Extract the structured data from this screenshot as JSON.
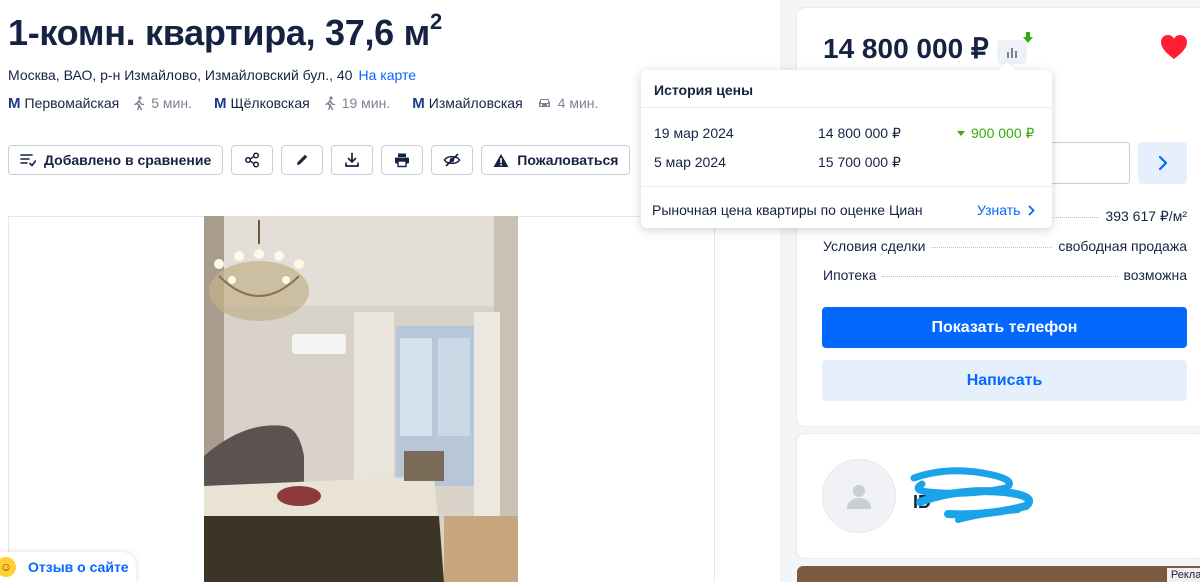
{
  "listing": {
    "title": "1-комн. квартира, 37,6 м",
    "title_sup": "2",
    "address": "Москва, ВАО, р-н Измайлово, Измайловский бул., 40",
    "map_link": "На карте"
  },
  "metro": [
    {
      "station": "Первомайская",
      "time": "5 мин.",
      "mode": "walk-icon"
    },
    {
      "station": "Щёлковская",
      "time": "19 мин.",
      "mode": "walk-icon"
    },
    {
      "station": "Измайловская",
      "time": "4 мин.",
      "mode": "car-icon"
    }
  ],
  "metro_icon_letter": "M",
  "actions": {
    "compare_label": "Добавлено в сравнение",
    "report_label": "Пожаловаться"
  },
  "price": {
    "value": "14 800 000 ₽",
    "per_meter": "393 617 ₽/м²"
  },
  "details": [
    {
      "key": "Условия сделки",
      "value": "свободная продажа"
    },
    {
      "key": "Ипотека",
      "value": "возможна"
    }
  ],
  "buttons": {
    "phone": "Показать телефон",
    "write": "Написать"
  },
  "agent": {
    "id_text": "ID"
  },
  "price_history": {
    "title": "История цены",
    "rows": [
      {
        "date": "19 мар 2024",
        "price": "14 800 000 ₽",
        "diff": "900 000 ₽"
      },
      {
        "date": "5 мар 2024",
        "price": "15 700 000 ₽",
        "diff": ""
      }
    ],
    "market_text": "Рыночная цена квартиры по оценке Циан",
    "market_link": "Узнать"
  },
  "feedback": {
    "label": "Отзыв о сайте"
  },
  "ad": {
    "label": "Реклама"
  },
  "colors": {
    "brand_blue": "#0468ff",
    "price_down_green": "#34ac0a",
    "heart_red": "#ff1f34",
    "text_dark": "#152242"
  }
}
